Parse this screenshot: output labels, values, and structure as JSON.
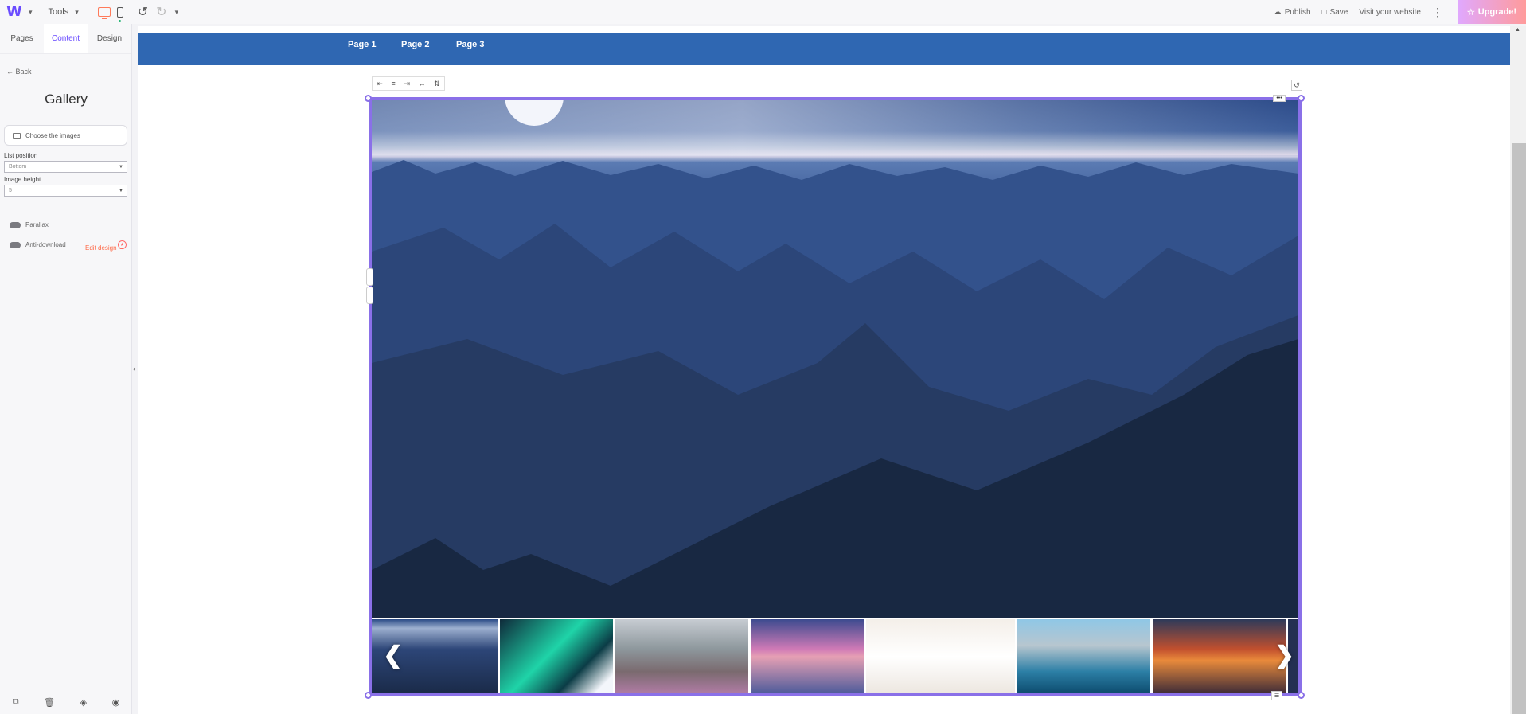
{
  "topbar": {
    "tools_label": "Tools",
    "publish_label": "Publish",
    "save_label": "Save",
    "visit_label": "Visit your website",
    "upgrade_label": "Upgrade!"
  },
  "sidebar": {
    "tabs": [
      {
        "label": "Pages"
      },
      {
        "label": "Content"
      },
      {
        "label": "Design"
      }
    ],
    "back_label": "Back",
    "panel_title": "Gallery",
    "choose_images_label": "Choose the images",
    "list_position": {
      "label": "List position",
      "value": "Bottom"
    },
    "image_height": {
      "label": "Image height",
      "value": "5"
    },
    "parallax_label": "Parallax",
    "anti_download_label": "Anti-download",
    "edit_design_label": "Edit design"
  },
  "site_nav": {
    "items": [
      {
        "label": "Page 1"
      },
      {
        "label": "Page 2"
      },
      {
        "label": "Page 3"
      }
    ]
  },
  "colors": {
    "accent": "#6a4cff",
    "nav_bg": "#2f67b2",
    "selection": "#8a70e8",
    "orange": "#ff6b4a"
  }
}
